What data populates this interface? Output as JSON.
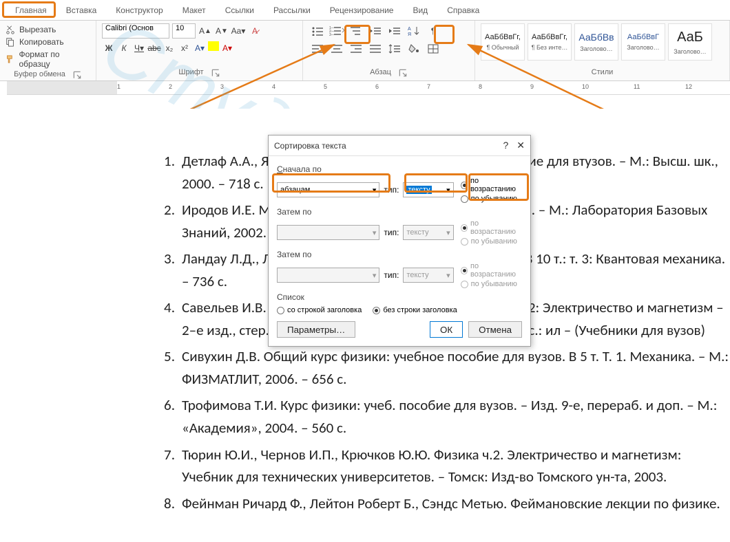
{
  "tabs": [
    "Главная",
    "Вставка",
    "Конструктор",
    "Макет",
    "Ссылки",
    "Рассылки",
    "Рецензирование",
    "Вид",
    "Справка"
  ],
  "clipboard": {
    "cut": "Вырезать",
    "copy": "Копировать",
    "format_painter": "Формат по образцу",
    "group": "Буфер обмена"
  },
  "font": {
    "name": "Calibri (Основ",
    "size": "10",
    "group": "Шрифт"
  },
  "paragraph": {
    "group": "Абзац"
  },
  "styles": {
    "group": "Стили",
    "items": [
      {
        "preview": "АаБбВвГг,",
        "name": "¶ Обычный",
        "color": "#222"
      },
      {
        "preview": "АаБбВвГг,",
        "name": "¶ Без инте…",
        "color": "#222"
      },
      {
        "preview": "АаБбВв",
        "name": "Заголово…",
        "color": "#2f5496",
        "big": true
      },
      {
        "preview": "АаБбВвГ",
        "name": "Заголово…",
        "color": "#2f5496"
      },
      {
        "preview": "АаБ",
        "name": "Заголово…",
        "color": "#222",
        "huge": true
      }
    ]
  },
  "annotations": {
    "numbering": "нумерация",
    "sort": "сортировка"
  },
  "ruler_numbers": [
    1,
    2,
    3,
    4,
    5,
    6,
    7,
    8,
    9,
    10,
    11,
    12
  ],
  "bibliography": [
    "Детлаф А.А., Яворский Б.М. Курс физики: Учебное пособие для втузов. – М.: Высш. шк., 2000. – 718 с.",
    "Иродов И.Е. Механика. Основные законы. – 5–е издание. – М.: Лаборатория Базовых Знаний, 2002. – 309 с.: ил.",
    "Ландау Л.Д., Лифшиц Е.М. Курс теоретической физики: В 10 т.: т. 3: Квантовая механика. – 736 с.",
    "Савельев И.В. Курс физики: учебное пособие. В 3–х тт. Т.2: Электричество и магнетизм – 2–е изд., стер. – СПб.: Издательство «Лань», 2007. – 496 с.: ил – (Учебники для вузов)",
    "Сивухин Д.В. Общий курс физики: учебное пособие для вузов. В 5 т. Т. 1. Механика. – М.: ФИЗМАТЛИТ, 2006. – 656 с.",
    "Трофимова Т.И. Курс физики: учеб. пособие для вузов. – Изд. 9-е, перераб. и доп. – М.: «Академия», 2004. – 560 с.",
    "Тюрин Ю.И., Чернов И.П., Крючков Ю.Ю. Физика ч.2. Электричество и магнетизм: Учебник для технических университетов. – Томск: Изд-во Томского ун-та, 2003.",
    "Фейнман Ричард Ф., Лейтон Роберт Б., Сэндс Метью. Феймановские лекции по физике."
  ],
  "dialog": {
    "title": "Сортировка текста",
    "first_label": "Сначала по",
    "then_label": "Затем по",
    "type_label": "тип:",
    "field_value": "абзацам",
    "type_value": "тексту",
    "asc": "по возрастанию",
    "desc": "по убыванию",
    "list_label": "Список",
    "with_header": "со строкой заголовка",
    "no_header": "без строки заголовка",
    "params": "Параметры…",
    "ok": "ОК",
    "cancel": "Отмена"
  }
}
